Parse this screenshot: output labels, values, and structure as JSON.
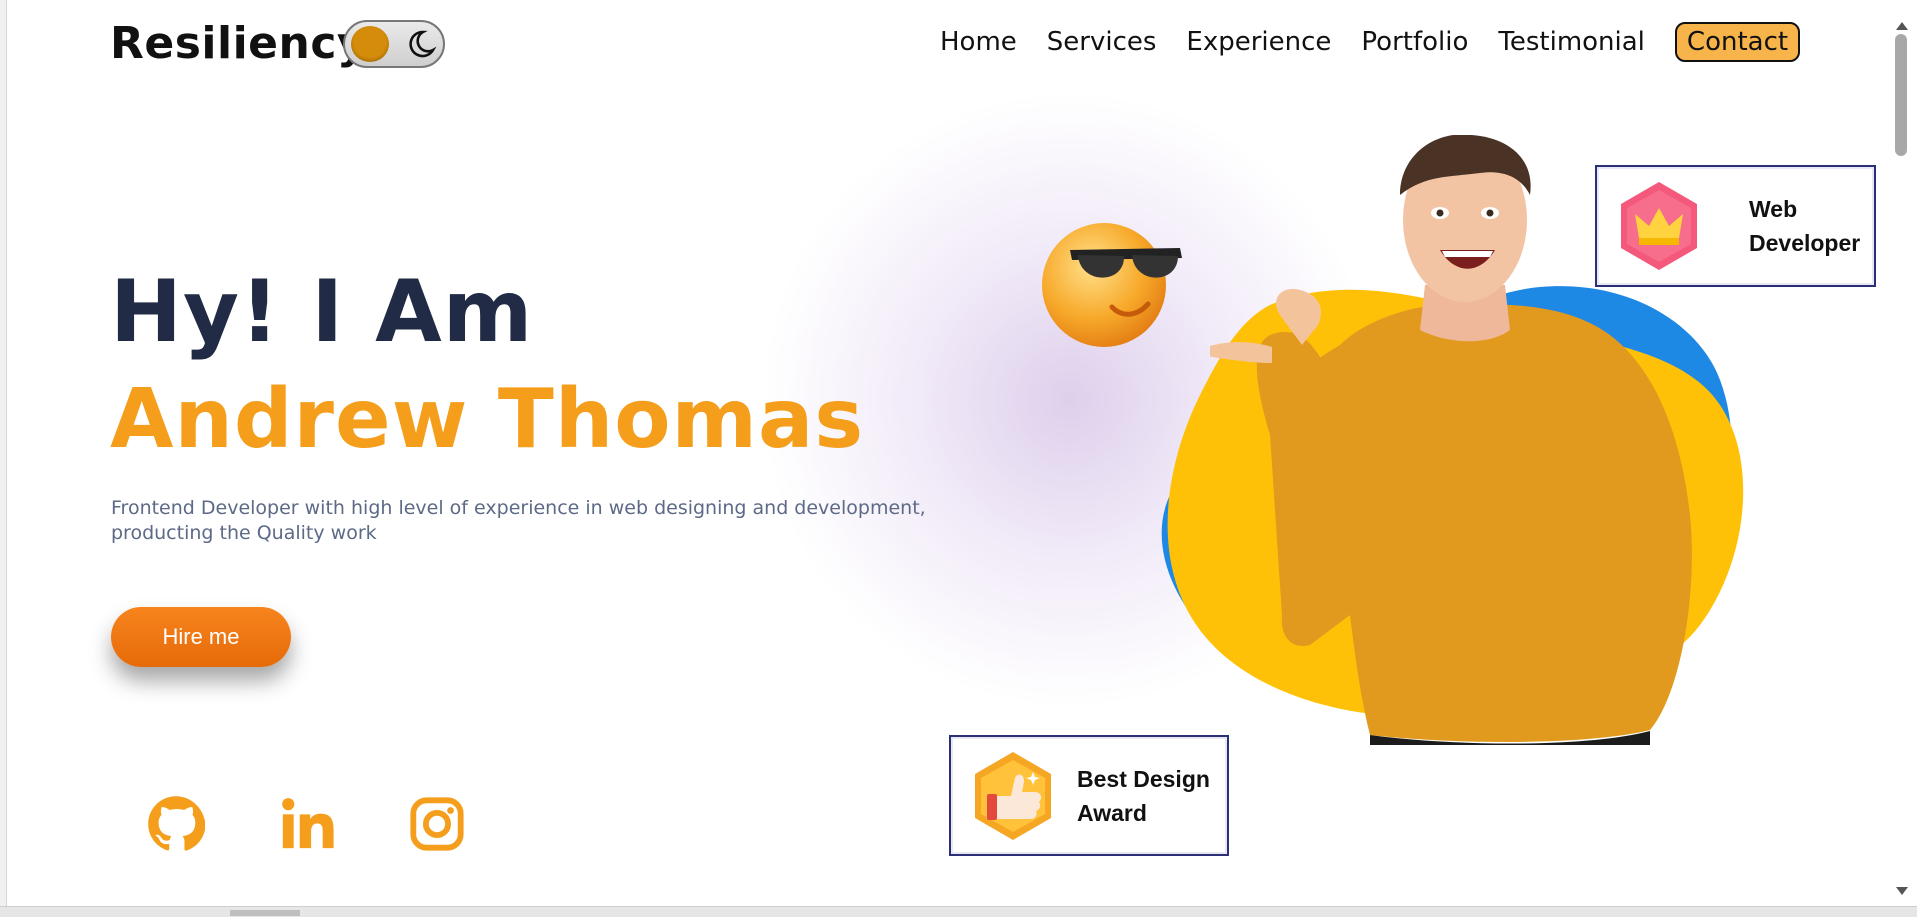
{
  "header": {
    "logo": "Resiliency",
    "theme_toggle": {
      "state": "light"
    },
    "nav": [
      "Home",
      "Services",
      "Experience",
      "Portfolio",
      "Testimonial"
    ],
    "contact_label": "Contact"
  },
  "hero": {
    "greeting": "Hy! I Am",
    "name": "Andrew Thomas",
    "description": "Frontend Developer with high level of experience in web designing and development, producting the Quality work",
    "cta_label": "Hire me"
  },
  "social": [
    "github-icon",
    "linkedin-icon",
    "instagram-icon"
  ],
  "cards": {
    "web_developer": {
      "line1": "Web",
      "line2": "Developer",
      "icon": "crown-icon"
    },
    "best_design": {
      "line1": "Best Design",
      "line2": "Award",
      "icon": "thumbs-up-icon"
    }
  },
  "colors": {
    "accent": "#f59e1b",
    "heading": "#222b45",
    "cta": "#e56b09",
    "contact_bg": "#f7b44a",
    "card_border": "#2c2f75"
  }
}
